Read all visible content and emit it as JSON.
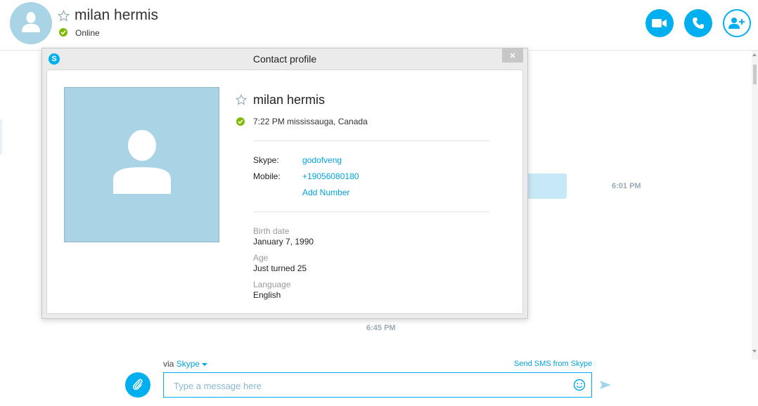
{
  "header": {
    "contact_name": "milan hermis",
    "status": "Online"
  },
  "conversation": {
    "time_1": "6:01 PM",
    "time_2": "6:45 PM"
  },
  "compose": {
    "via_label": "via",
    "via_service": "Skype",
    "sms_link": "Send SMS from Skype",
    "placeholder": "Type a message here"
  },
  "dialog": {
    "title": "Contact profile",
    "name": "milan hermis",
    "local_time": "7:22 PM mississauga, Canada",
    "fields": {
      "skype_label": "Skype:",
      "skype_value": "godofveng",
      "mobile_label": "Mobile:",
      "mobile_value": "+19056080180",
      "add_number": "Add Number"
    },
    "details": {
      "birth_label": "Birth date",
      "birth_value": "January 7, 1990",
      "age_label": "Age",
      "age_value": "Just turned 25",
      "language_label": "Language",
      "language_value": "English"
    }
  },
  "colors": {
    "accent": "#00aff0",
    "link": "#00a4de",
    "online": "#7fba00",
    "avatar_bg": "#a9d4e6"
  },
  "icons": {
    "header": [
      "avatar-icon",
      "star-icon",
      "check-icon",
      "video-icon",
      "phone-icon",
      "add-contact-icon"
    ],
    "dialog": [
      "skype-icon",
      "close-icon",
      "star-icon",
      "check-icon"
    ],
    "compose": [
      "paperclip-icon",
      "emoji-icon",
      "send-icon"
    ]
  }
}
